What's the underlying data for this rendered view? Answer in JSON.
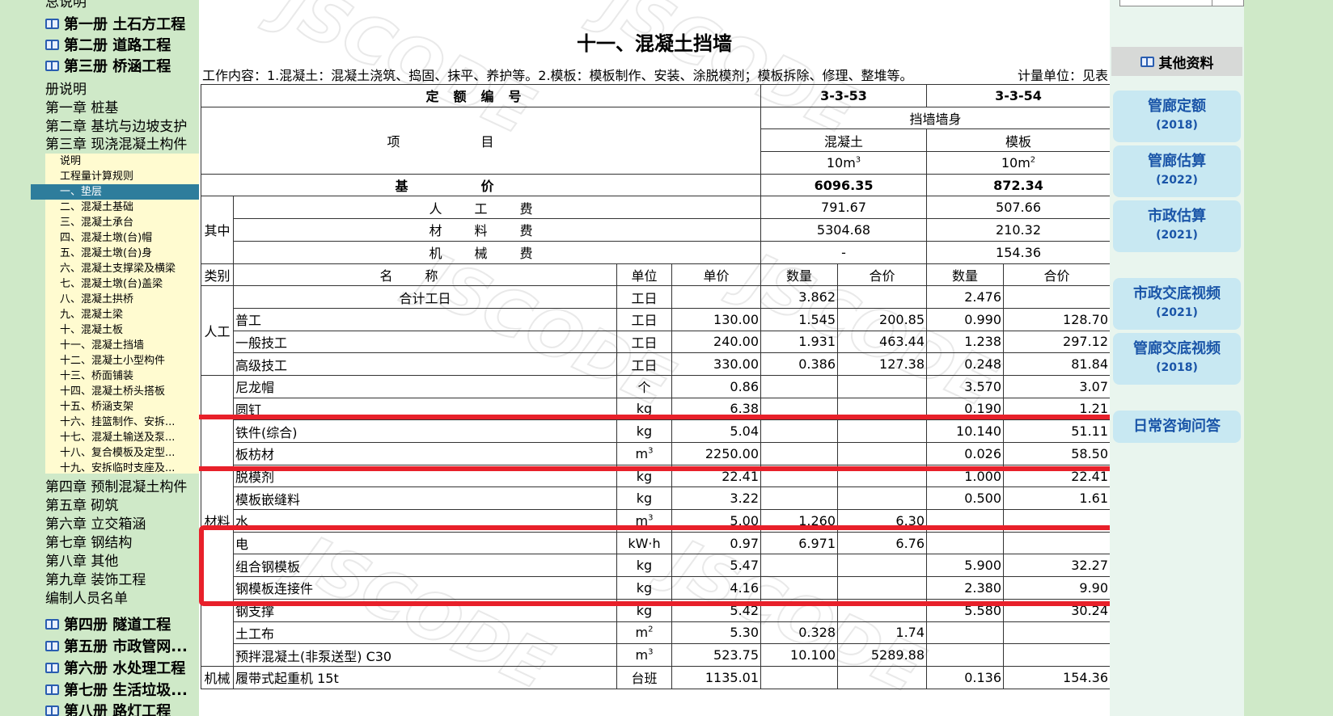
{
  "sidebar": {
    "top": "总说明",
    "books_top": [
      "第一册 土石方工程",
      "第二册 道路工程",
      "第三册 桥涵工程"
    ],
    "book3_intro": "册说明",
    "chapters_a": [
      "第一章 桩基",
      "第二章 基坑与边坡支护",
      "第三章 现浇混凝土构件"
    ],
    "subitems": [
      "说明",
      "工程量计算规则",
      "一、垫层",
      "二、混凝土基础",
      "三、混凝土承台",
      "四、混凝土墩(台)帽",
      "五、混凝土墩(台)身",
      "六、混凝土支撑梁及横梁",
      "七、混凝土墩(台)盖梁",
      "八、混凝土拱桥",
      "九、混凝土梁",
      "十、混凝土板",
      "十一、混凝土挡墙",
      "十二、混凝土小型构件",
      "十三、桥面铺装",
      "十四、混凝土桥头搭板",
      "十五、桥涵支架",
      "十六、挂篮制作、安拆...",
      "十七、混凝土输送及泵...",
      "十八、复合模板及定型...",
      "十九、安拆临时支座及..."
    ],
    "chapters_b": [
      "第四章 预制混凝土构件",
      "第五章 砌筑",
      "第六章 立交箱涵",
      "第七章 钢结构",
      "第八章 其他",
      "第九章 装饰工程",
      "编制人员名单"
    ],
    "books_bottom": [
      "第四册 隧道工程",
      "第五册 市政管网...",
      "第六册 水处理工程",
      "第七册 生活垃圾...",
      "第八册 路灯工程"
    ]
  },
  "main": {
    "title": "十一、混凝土挡墙",
    "work_content": "工作内容：1.混凝土：混凝土浇筑、捣固、抹平、养护等。2.模板：模板制作、安装、涂脱模剂；模板拆除、修理、整堆等。",
    "unit_label": "计量单位：见表",
    "table": {
      "h_code": "定额编号",
      "code1": "3-3-53",
      "code2": "3-3-54",
      "h_item": "项目",
      "group": "挡墙墙身",
      "sub1": "混凝土",
      "sub2": "模板",
      "u1": "10m",
      "u1sup": "3",
      "u2": "10m",
      "u2sup": "2",
      "h_base": "基价",
      "base1": "6096.35",
      "base2": "872.34",
      "qizhong": "其中",
      "fees": [
        {
          "name": "人工费",
          "v1": "791.67",
          "v2": "507.66"
        },
        {
          "name": "材料费",
          "v1": "5304.68",
          "v2": "210.32"
        },
        {
          "name": "机械费",
          "v1": "-",
          "v2": "154.36"
        }
      ],
      "cols": {
        "cat": "类别",
        "name": "名称",
        "unit": "单位",
        "price": "单价",
        "qty": "数量",
        "total": "合价"
      },
      "rows": [
        {
          "cat": "",
          "name": "合计工日",
          "unit": "工日",
          "sup": "",
          "price": "",
          "q1": "3.862",
          "t1": "",
          "q2": "2.476",
          "t2": "",
          "center": true
        },
        {
          "cat": "人工",
          "name": "普工",
          "unit": "工日",
          "sup": "",
          "price": "130.00",
          "q1": "1.545",
          "t1": "200.85",
          "q2": "0.990",
          "t2": "128.70"
        },
        {
          "cat": "",
          "name": "一般技工",
          "unit": "工日",
          "sup": "",
          "price": "240.00",
          "q1": "1.931",
          "t1": "463.44",
          "q2": "1.238",
          "t2": "297.12"
        },
        {
          "cat": "",
          "name": "高级技工",
          "unit": "工日",
          "sup": "",
          "price": "330.00",
          "q1": "0.386",
          "t1": "127.38",
          "q2": "0.248",
          "t2": "81.84"
        },
        {
          "cat": "",
          "name": "尼龙帽",
          "unit": "个",
          "sup": "",
          "price": "0.86",
          "q1": "",
          "t1": "",
          "q2": "3.570",
          "t2": "3.07"
        },
        {
          "cat": "",
          "name": "圆钉",
          "unit": "kg",
          "sup": "",
          "price": "6.38",
          "q1": "",
          "t1": "",
          "q2": "0.190",
          "t2": "1.21"
        },
        {
          "cat": "",
          "name": "铁件(综合)",
          "unit": "kg",
          "sup": "",
          "price": "5.04",
          "q1": "",
          "t1": "",
          "q2": "10.140",
          "t2": "51.11"
        },
        {
          "cat": "",
          "name": "板枋材",
          "unit": "m",
          "sup": "3",
          "price": "2250.00",
          "q1": "",
          "t1": "",
          "q2": "0.026",
          "t2": "58.50"
        },
        {
          "cat": "",
          "name": "脱模剂",
          "unit": "kg",
          "sup": "",
          "price": "22.41",
          "q1": "",
          "t1": "",
          "q2": "1.000",
          "t2": "22.41"
        },
        {
          "cat": "",
          "name": "模板嵌缝料",
          "unit": "kg",
          "sup": "",
          "price": "3.22",
          "q1": "",
          "t1": "",
          "q2": "0.500",
          "t2": "1.61"
        },
        {
          "cat": "材料",
          "name": "水",
          "unit": "m",
          "sup": "3",
          "price": "5.00",
          "q1": "1.260",
          "t1": "6.30",
          "q2": "",
          "t2": ""
        },
        {
          "cat": "",
          "name": "电",
          "unit": "kW·h",
          "sup": "",
          "price": "0.97",
          "q1": "6.971",
          "t1": "6.76",
          "q2": "",
          "t2": ""
        },
        {
          "cat": "",
          "name": "组合钢模板",
          "unit": "kg",
          "sup": "",
          "price": "5.47",
          "q1": "",
          "t1": "",
          "q2": "5.900",
          "t2": "32.27"
        },
        {
          "cat": "",
          "name": "钢模板连接件",
          "unit": "kg",
          "sup": "",
          "price": "4.16",
          "q1": "",
          "t1": "",
          "q2": "2.380",
          "t2": "9.90"
        },
        {
          "cat": "",
          "name": "钢支撑",
          "unit": "kg",
          "sup": "",
          "price": "5.42",
          "q1": "",
          "t1": "",
          "q2": "5.580",
          "t2": "30.24"
        },
        {
          "cat": "",
          "name": "土工布",
          "unit": "m",
          "sup": "2",
          "price": "5.30",
          "q1": "0.328",
          "t1": "1.74",
          "q2": "",
          "t2": ""
        },
        {
          "cat": "",
          "name": "预拌混凝土(非泵送型) C30",
          "unit": "m",
          "sup": "3",
          "price": "523.75",
          "q1": "10.100",
          "t1": "5289.88",
          "q2": "",
          "t2": ""
        },
        {
          "cat": "机械",
          "name": "履带式起重机 15t",
          "unit": "台班",
          "sup": "",
          "price": "1135.01",
          "q1": "",
          "t1": "",
          "q2": "0.136",
          "t2": "154.36"
        }
      ]
    }
  },
  "right": {
    "header": "其他资料",
    "links": [
      {
        "title": "管廊定额",
        "year": "(2018)"
      },
      {
        "title": "管廊估算",
        "year": "(2022)"
      },
      {
        "title": "市政估算",
        "year": "(2021)"
      },
      {
        "title": "市政交底视频",
        "year": "(2021)"
      },
      {
        "title": "管廊交底视频",
        "year": "(2018)"
      },
      {
        "title": "日常咨询问答",
        "year": ""
      }
    ]
  },
  "colors": {
    "highlight": "#e8202a",
    "active": "#2e7d9c",
    "link": "#1a55a8"
  }
}
